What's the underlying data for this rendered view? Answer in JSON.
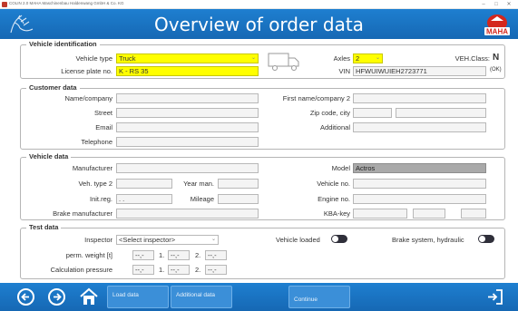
{
  "window": {
    "title": "COLIN 2.0  MAHA Maschinenbau Haldenwang GmbH & Co. KG",
    "minimize": "–",
    "maximize": "□",
    "close": "✕"
  },
  "header": {
    "title": "Overview of order data"
  },
  "vehicle_identification": {
    "legend": "Vehicle identification",
    "vehicle_type_label": "Vehicle type",
    "vehicle_type_value": "Truck",
    "axles_label": "Axles",
    "axles_value": "2",
    "veh_class_label": "VEH.Class:",
    "veh_class_value": "N",
    "license_plate_label": "License plate no.",
    "license_plate_value": "K - RS 35",
    "vin_label": "VIN",
    "vin_value": "HFWUIWUIEH2723771",
    "vin_status": "(OK)"
  },
  "customer_data": {
    "legend": "Customer data",
    "name_company_label": "Name/company",
    "first_name_label": "First name/company 2",
    "street_label": "Street",
    "zip_city_label": "Zip code, city",
    "email_label": "Email",
    "additional_label": "Additional",
    "telephone_label": "Telephone"
  },
  "vehicle_data": {
    "legend": "Vehicle data",
    "manufacturer_label": "Manufacturer",
    "model_label": "Model",
    "model_value": "Actros",
    "veh_type2_label": "Veh. type 2",
    "year_man_label": "Year man.",
    "vehicle_no_label": "Vehicle no.",
    "init_reg_label": "Init.reg.",
    "init_reg_value": ". .",
    "mileage_label": "Mileage",
    "engine_no_label": "Engine no.",
    "brake_manufacturer_label": "Brake manufacturer",
    "kba_key_label": "KBA-key"
  },
  "test_data": {
    "legend": "Test data",
    "inspector_label": "Inspector",
    "inspector_value": "<Select inspector>",
    "vehicle_loaded_label": "Vehicle loaded",
    "brake_system_label": "Brake system, hydraulic",
    "perm_weight_label": "perm. weight [t]",
    "calc_pressure_label": "Calculation pressure",
    "placeholder": "--,-",
    "one_label": "1.",
    "two_label": "2."
  },
  "footer": {
    "load_data": "Load data",
    "additional_data": "Additional data",
    "continue": "Continue"
  },
  "colors": {
    "accent": "#1a73c4",
    "highlight": "#ffff00",
    "toggle": "#2f2f3a"
  }
}
